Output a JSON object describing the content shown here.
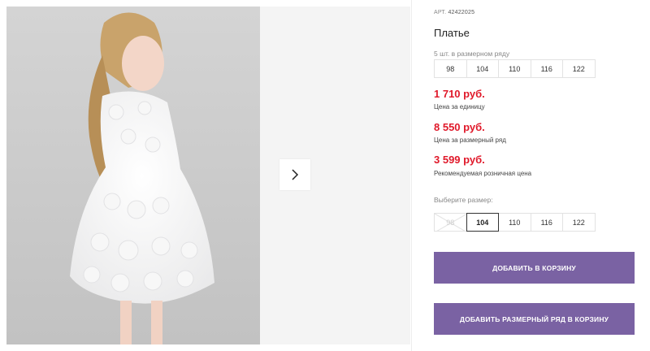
{
  "product": {
    "article_prefix": "АРТ.",
    "article_number": "42422025",
    "title": "Платье"
  },
  "series": {
    "label": "5 шт. в размерном ряду",
    "sizes": [
      "98",
      "104",
      "110",
      "116",
      "122"
    ]
  },
  "prices": {
    "unit_price": "1 710 руб.",
    "unit_label": "Цена за единицу",
    "series_price": "8 550 руб.",
    "series_label": "Цена за размерный ряд",
    "retail_price": "3 599 руб.",
    "retail_label": "Рекомендуемая розничная цена"
  },
  "size_select": {
    "label": "Выберите размер:",
    "sizes": [
      "98",
      "104",
      "110",
      "116",
      "122"
    ],
    "selected": "104",
    "unavailable": "98"
  },
  "buttons": {
    "add_to_cart": "ДОБАВИТЬ В КОРЗИНУ",
    "add_series": "ДОБАВИТЬ РАЗМЕРНЫЙ РЯД В КОРЗИНУ"
  },
  "icons": {
    "next": "chevron-right-icon"
  },
  "colors": {
    "price": "#e0192a",
    "button": "#7a62a3"
  }
}
